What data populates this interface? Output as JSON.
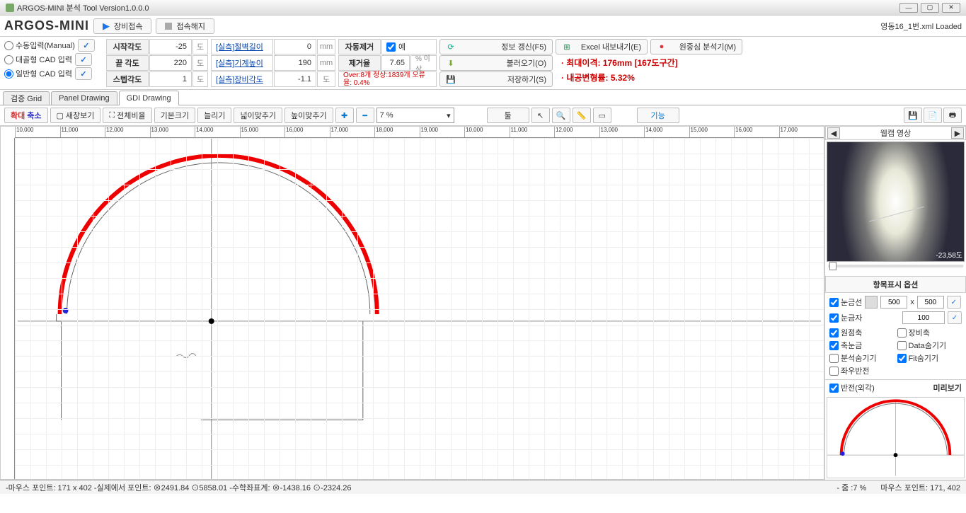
{
  "title": "ARGOS-MINI 분석 Tool Version1.0.0.0",
  "logo": "ARGOS-MINI",
  "connect": "장비접속",
  "disconnect": "접속해지",
  "loaded": "영동16_1번.xml Loaded",
  "radios": {
    "manual": "수동입력(Manual)",
    "opencad": "대골형 CAD 입력",
    "gencad": "일반형 CAD 입력"
  },
  "angles": {
    "start_lbl": "시작각도",
    "start_val": "-25",
    "deg": "도",
    "end_lbl": "끝 각도",
    "end_val": "220",
    "step_lbl": "스텝각도",
    "step_val": "1"
  },
  "meas": {
    "wall_lbl": "[실측]절벽길이",
    "wall_val": "0",
    "mm": "mm",
    "mach_lbl": "[실측]기계높이",
    "mach_val": "190",
    "equip_lbl": "[실측]장비각도",
    "equip_val": "-1.1"
  },
  "auto": {
    "remove_lbl": "자동제거",
    "yes": "예",
    "rate_lbl": "제거율",
    "rate_val": "7.65",
    "rate_unit": "% 이상",
    "over": "Over:8개 정상:1839개 오류율: 0.4%"
  },
  "actions": {
    "refresh": "정보 갱신(F5)",
    "excel": "Excel 내보내기(E)",
    "center": "원중심 분석기(M)",
    "load": "불러오기(O)",
    "save": "저장하기(S)"
  },
  "results": {
    "r1": "· 최대이격: 176mm  [167도구간]",
    "r2": "· 내공변형률: 5.32%"
  },
  "maintabs": {
    "t1": "검증 Grid",
    "t2": "Panel Drawing",
    "t3": "GDI Drawing"
  },
  "toolbar": {
    "zoomin": "확대",
    "zoomout": "축소",
    "newview": "새창보기",
    "fitall": "전체비율",
    "origsize": "기본크기",
    "stretch": "늘리기",
    "fitw": "넓이맞추기",
    "fith": "높이맞추기",
    "pct": "7 %",
    "tool": "툴",
    "func": "기능"
  },
  "ruler": [
    "10,000",
    "11,000",
    "12,000",
    "13,000",
    "14,000",
    "15,000",
    "16,000",
    "17,000",
    "18,000",
    "19,000",
    "10,000",
    "11,000",
    "12,000",
    "13,000",
    "14,000",
    "15,000",
    "16,000",
    "17,000"
  ],
  "webcam": {
    "title": "웹캡 영상",
    "angle": "-23,58도"
  },
  "opts": {
    "hdr": "항목표시 옵션",
    "gridline": "눈금선",
    "g1": "500",
    "gx": "x",
    "g2": "500",
    "gridmark": "눈금자",
    "gm": "100",
    "origin": "원점축",
    "equip": "장비축",
    "axis": "축눈금",
    "datahide": "Data숨기기",
    "anahide": "분석숨기기",
    "fithide": "Fit숨기기",
    "flip": "좌우반전"
  },
  "preview": {
    "flip": "반전(외각)",
    "title": "미리보기"
  },
  "status": {
    "left": "-마우스 포인트: 171 x 402  -실제에서 포인트: ⊗2491.84 ⊙5858.01  -수학좌표계: ⊗-1438.16 ⊙-2324.26",
    "zoom": "- 줌 :7 %",
    "mouse": "마우스 포인트: 171, 402"
  }
}
